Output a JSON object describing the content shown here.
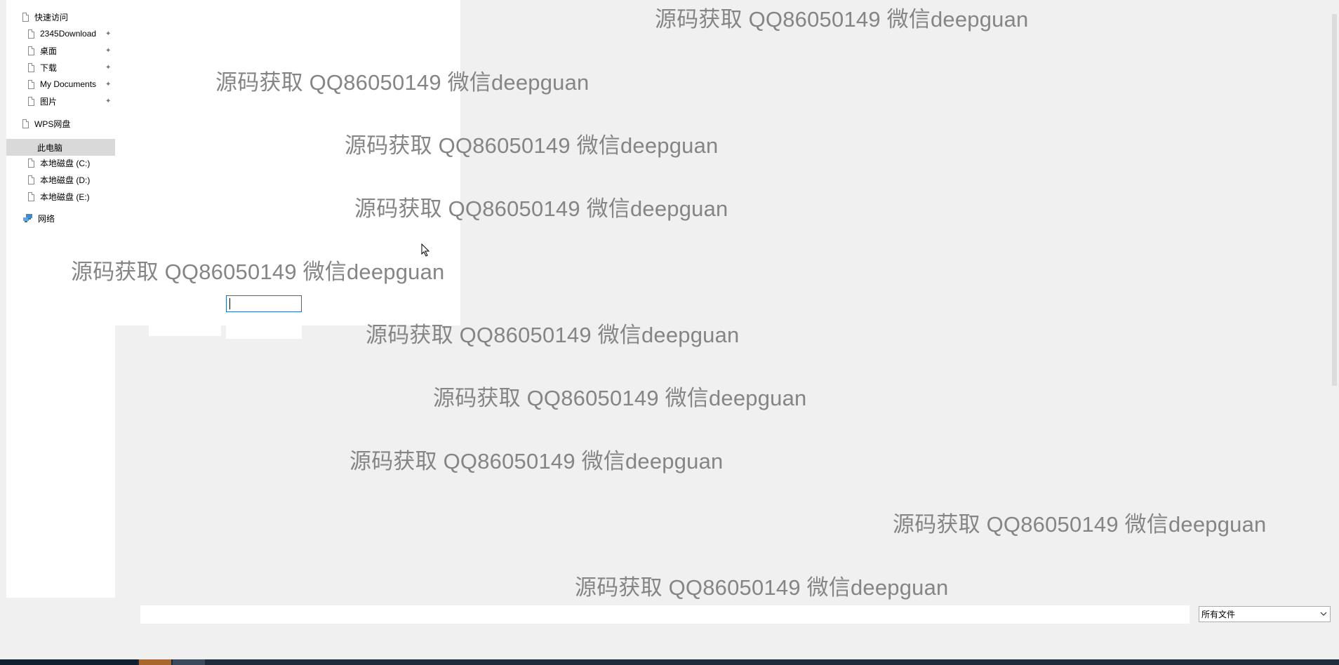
{
  "nav": {
    "quick_access": "快速访问",
    "pinned": [
      "2345Download",
      "桌面",
      "下载",
      "My Documents",
      "图片"
    ],
    "wps": "WPS网盘",
    "this_pc": "此电脑",
    "drives": [
      "本地磁盘 (C:)",
      "本地磁盘 (D:)",
      "本地磁盘 (E:)"
    ],
    "network": "网络"
  },
  "watermark": "源码获取 QQ86050149 微信deepguan",
  "filter": {
    "selected": "所有文件"
  },
  "filename": {
    "value": ""
  },
  "colors": {
    "selection": "#d9d9d9",
    "focus_border": "#1e70c8",
    "watermark": "#858585"
  }
}
